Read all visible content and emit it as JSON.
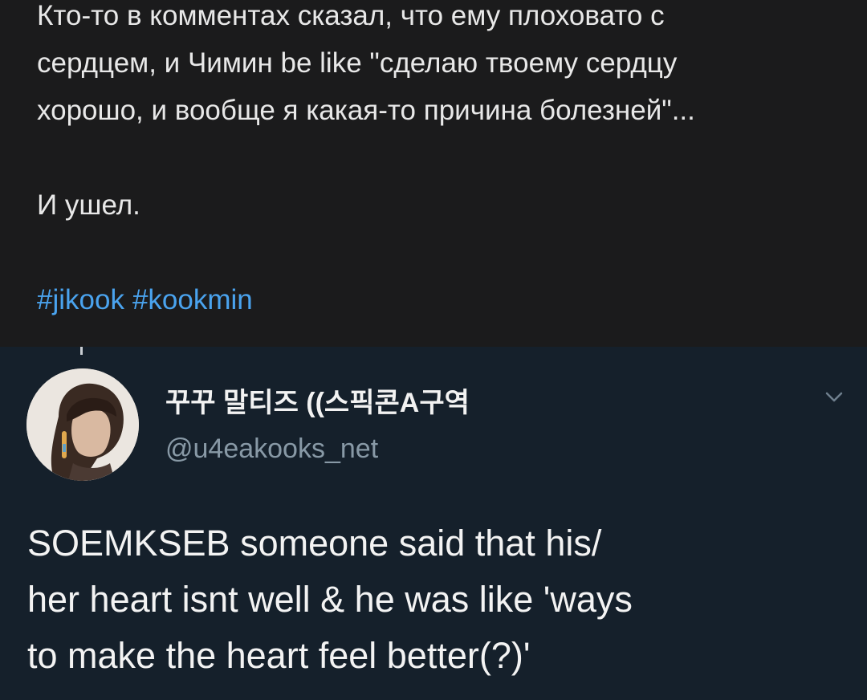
{
  "top_post": {
    "lines": [
      "Кто-то в комментах сказал, что ему плоховато с",
      "сердцем, и Чимин be like \"сделаю твоему сердцу",
      "хорошо, и вообще я какая-то причина болезней\"...",
      "И ушел."
    ],
    "hashtags": [
      "#jikook",
      "#kookmin"
    ]
  },
  "tweet": {
    "display_name": "꾸꾸 말티즈 ((스픽콘A구역",
    "handle": "@u4eakooks_net",
    "text_lines": [
      "SOEMKSEB someone said that his/",
      "her heart isnt well & he was like 'ways",
      "to make the heart feel better(?)'"
    ],
    "avatar_icon": "user-avatar-photo",
    "menu_icon": "chevron-down-icon"
  },
  "colors": {
    "top_bg": "#1b1b1c",
    "tweet_bg": "#15202b",
    "hashtag": "#4aa3ee",
    "secondary_text": "#8899a6"
  }
}
